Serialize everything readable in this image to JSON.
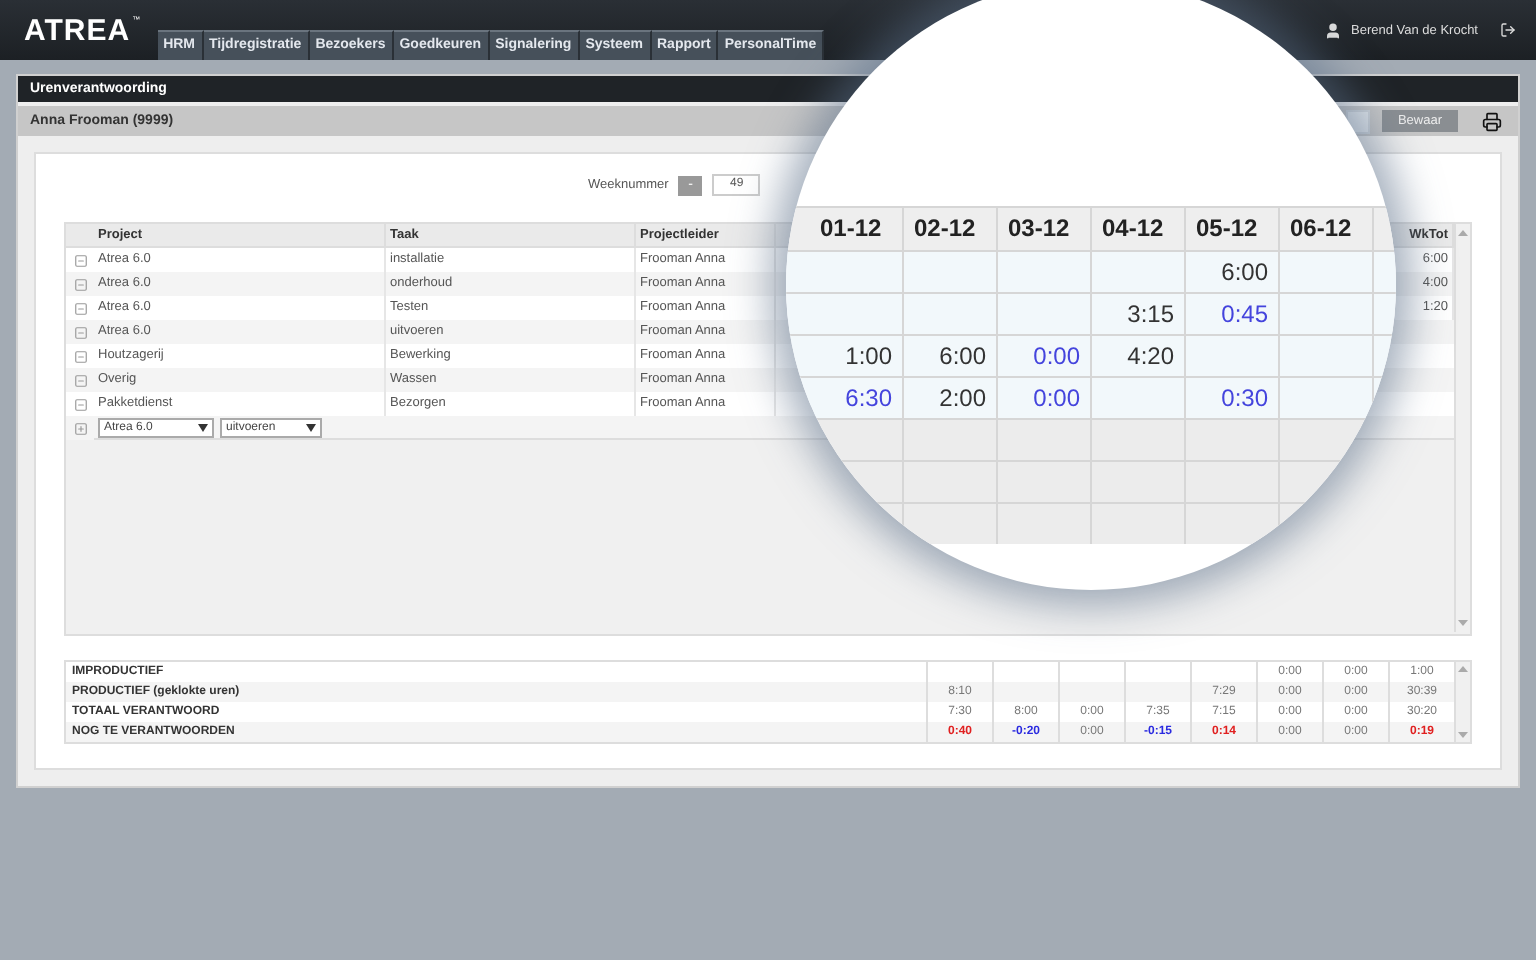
{
  "header": {
    "logo": "ATREA",
    "logo_mark": "™",
    "user": "Berend Van de Krocht"
  },
  "nav": [
    {
      "label": "HRM",
      "selected": false
    },
    {
      "label": "Tijdregistratie",
      "selected": false
    },
    {
      "label": "Bezoekers",
      "selected": false
    },
    {
      "label": "Goedkeuren",
      "selected": false
    },
    {
      "label": "Signalering",
      "selected": false
    },
    {
      "label": "Systeem",
      "selected": false
    },
    {
      "label": "Rapport",
      "selected": false
    },
    {
      "label": "PersonalTime",
      "selected": false
    }
  ],
  "panel": {
    "title": "Urenverantwoording",
    "employee": "Anna Frooman (9999)",
    "save_button": "Bewaar"
  },
  "week": {
    "label": "Weeknummer",
    "prev_button": "-",
    "value": "49"
  },
  "table": {
    "columns": [
      "Project",
      "Taak",
      "Projectleider",
      "WkTot"
    ],
    "rows": [
      {
        "project": "Atrea 6.0",
        "task": "installatie",
        "lead": "Frooman Anna",
        "total": "6:00",
        "expanded": true
      },
      {
        "project": "Atrea 6.0",
        "task": "onderhoud",
        "lead": "Frooman Anna",
        "total": "4:00",
        "expanded": true
      },
      {
        "project": "Atrea 6.0",
        "task": "Testen",
        "lead": "Frooman Anna",
        "total": "1:20",
        "expanded": true
      },
      {
        "project": "Atrea 6.0",
        "task": "uitvoeren",
        "lead": "Frooman Anna",
        "total": null,
        "expanded": true
      },
      {
        "project": "Houtzagerij",
        "task": "Bewerking",
        "lead": "Frooman Anna",
        "total": null,
        "expanded": true
      },
      {
        "project": "Overig",
        "task": "Wassen",
        "lead": "Frooman Anna",
        "total": null,
        "expanded": true
      },
      {
        "project": "Pakketdienst",
        "task": "Bezorgen",
        "lead": "Frooman Anna",
        "total": null,
        "expanded": true
      }
    ],
    "new_row": {
      "project": "Atrea 6.0",
      "task": "uitvoeren"
    }
  },
  "magnifier": {
    "columns": [
      "01-12",
      "02-12",
      "03-12",
      "04-12",
      "05-12",
      "06-12"
    ],
    "rows": [
      [
        null,
        null,
        null,
        null,
        {
          "text": "6:00",
          "highlight": false
        },
        null
      ],
      [
        null,
        null,
        null,
        {
          "text": "3:15",
          "highlight": false
        },
        {
          "text": "0:45",
          "highlight": true
        },
        null
      ],
      [
        {
          "text": "1:00",
          "highlight": false
        },
        {
          "text": "6:00",
          "highlight": false
        },
        {
          "text": "0:00",
          "highlight": true
        },
        {
          "text": "4:20",
          "highlight": false
        },
        null,
        null
      ],
      [
        {
          "text": "6:30",
          "highlight": true
        },
        {
          "text": "2:00",
          "highlight": false
        },
        {
          "text": "0:00",
          "highlight": true
        },
        null,
        {
          "text": "0:30",
          "highlight": true
        },
        null
      ]
    ]
  },
  "summary": {
    "rows": [
      {
        "label": "IMPRODUCTIEF",
        "cells": [
          null,
          null,
          null,
          null,
          null,
          {
            "text": "0:00"
          },
          {
            "text": "0:00"
          },
          {
            "text": "1:00"
          }
        ]
      },
      {
        "label": "PRODUCTIEF (geklokte uren)",
        "cells": [
          {
            "text": "8:10"
          },
          null,
          null,
          null,
          {
            "text": "7:29"
          },
          {
            "text": "0:00"
          },
          {
            "text": "0:00"
          },
          {
            "text": "30:39"
          }
        ]
      },
      {
        "label": "TOTAAL VERANTWOORD",
        "cells": [
          {
            "text": "7:30"
          },
          {
            "text": "8:00"
          },
          {
            "text": "0:00"
          },
          {
            "text": "7:35"
          },
          {
            "text": "7:15"
          },
          {
            "text": "0:00"
          },
          {
            "text": "0:00"
          },
          {
            "text": "30:20"
          }
        ]
      },
      {
        "label": "NOG TE VERANTWOORDEN",
        "cells": [
          {
            "text": "0:40",
            "color": "#e02020"
          },
          {
            "text": "-0:20",
            "color": "#2a2ae0"
          },
          {
            "text": "0:00"
          },
          {
            "text": "-0:15",
            "color": "#2a2ae0"
          },
          {
            "text": "0:14",
            "color": "#e02020"
          },
          {
            "text": "0:00"
          },
          {
            "text": "0:00"
          },
          {
            "text": "0:19",
            "color": "#e02020"
          }
        ]
      }
    ]
  }
}
